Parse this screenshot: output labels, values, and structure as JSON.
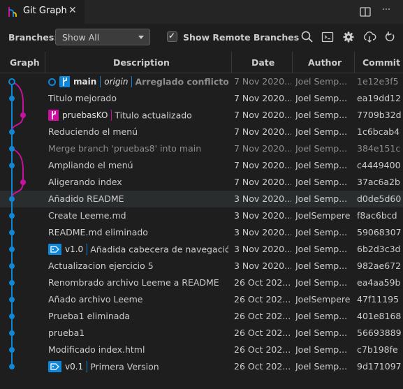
{
  "tab": {
    "title": "Git Graph",
    "icon": "git-graph-icon",
    "close": "✕"
  },
  "tab_actions": {
    "split": "split-editor-icon",
    "more": "···"
  },
  "controls": {
    "branches_label": "Branches:",
    "branches_value": "Show All",
    "show_remote_label": "Show Remote Branches",
    "show_remote_checked": true,
    "icons": [
      "search-icon",
      "terminal-icon",
      "settings-icon",
      "fetch-icon",
      "refresh-icon"
    ]
  },
  "columns": {
    "graph": "Graph",
    "description": "Description",
    "date": "Date",
    "author": "Author",
    "commit": "Commit"
  },
  "colors": {
    "blue": "#0e87d8",
    "magenta": "#c8119e",
    "background": "#1e1e1e"
  },
  "commits": [
    {
      "message": "Arreglado conflicto ...",
      "date": "7 Nov 2020...",
      "author": "Joel Semp...",
      "hash": "1e12e3f5",
      "refs": [
        {
          "type": "branch",
          "name": "main",
          "remote": "origin",
          "color": "blue"
        }
      ],
      "head": true
    },
    {
      "message": "Titulo mejorado",
      "date": "7 Nov 2020...",
      "author": "Joel Semp...",
      "hash": "ea19dd12",
      "refs": []
    },
    {
      "message": "Titulo actualizado",
      "date": "7 Nov 2020...",
      "author": "Joel Semp...",
      "hash": "7709b32d",
      "refs": [
        {
          "type": "branch",
          "name": "pruebasKO",
          "color": "magenta"
        }
      ]
    },
    {
      "message": "Reduciendo el menú",
      "date": "7 Nov 2020...",
      "author": "Joel Semp...",
      "hash": "1c6bcab4",
      "refs": []
    },
    {
      "message": "Merge branch 'pruebas8' into main",
      "date": "7 Nov 2020...",
      "author": "Joel Semp...",
      "hash": "384e151c",
      "refs": [],
      "merge": true
    },
    {
      "message": "Ampliando el menú",
      "date": "7 Nov 2020...",
      "author": "Joel Semp...",
      "hash": "c4449400",
      "refs": []
    },
    {
      "message": "Aligerando index",
      "date": "7 Nov 2020...",
      "author": "Joel Semp...",
      "hash": "37ac6a2b",
      "refs": []
    },
    {
      "message": "Añadido README",
      "date": "3 Nov 2020...",
      "author": "Joel Semp...",
      "hash": "d0de5d60",
      "refs": [],
      "highlight": true
    },
    {
      "message": "Create Leeme.md",
      "date": "3 Nov 2020...",
      "author": "JoelSempere",
      "hash": "f8ac6bcd",
      "refs": []
    },
    {
      "message": "README.md eliminado",
      "date": "3 Nov 2020...",
      "author": "Joel Semp...",
      "hash": "59068307",
      "refs": []
    },
    {
      "message": "Añadida cabecera de navegación",
      "date": "3 Nov 2020...",
      "author": "Joel Semp...",
      "hash": "6b2d3c3d",
      "refs": [
        {
          "type": "tag",
          "name": "v1.0",
          "color": "blue"
        }
      ]
    },
    {
      "message": "Actualizacion ejercicio 5",
      "date": "3 Nov 2020...",
      "author": "Joel Semp...",
      "hash": "982ae672",
      "refs": []
    },
    {
      "message": "Renombrado archivo Leeme a README",
      "date": "26 Oct 202...",
      "author": "Joel Semp...",
      "hash": "ea4aa59b",
      "refs": []
    },
    {
      "message": "Añado archivo Leeme",
      "date": "26 Oct 202...",
      "author": "JoelSempere",
      "hash": "47f11195",
      "refs": []
    },
    {
      "message": "Prueba1 eliminada",
      "date": "26 Oct 202...",
      "author": "Joel Semp...",
      "hash": "401e8168",
      "refs": []
    },
    {
      "message": "prueba1",
      "date": "26 Oct 202...",
      "author": "Joel Semp...",
      "hash": "56693889",
      "refs": []
    },
    {
      "message": "Modificado index.html",
      "date": "26 Oct 202...",
      "author": "Joel Semp...",
      "hash": "c7b198fe",
      "refs": []
    },
    {
      "message": "Primera Version",
      "date": "26 Oct 202...",
      "author": "Joel Semp...",
      "hash": "9d171097",
      "refs": [
        {
          "type": "tag",
          "name": "v0.1",
          "color": "blue"
        }
      ]
    }
  ]
}
